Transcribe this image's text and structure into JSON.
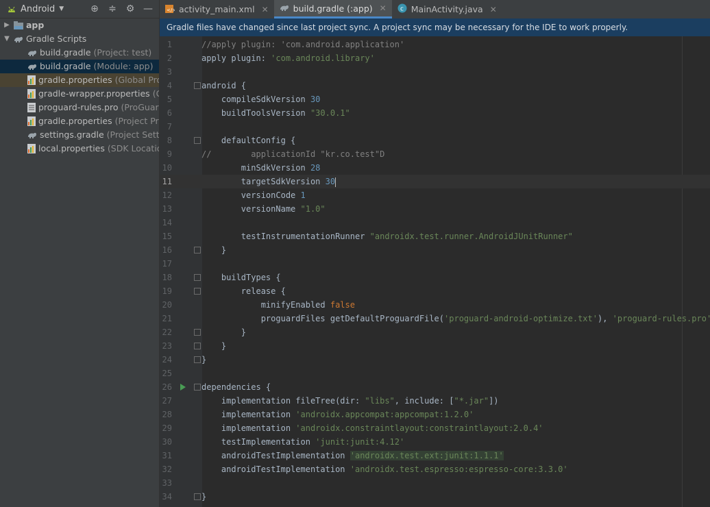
{
  "project_panel": {
    "view_label": "Android",
    "tree": [
      {
        "label": "app",
        "hint": "",
        "level": 0,
        "arrow": "▶",
        "icon": "folder-icon",
        "bold": true,
        "state": ""
      },
      {
        "label": "Gradle Scripts",
        "hint": "",
        "level": 0,
        "arrow": "▼",
        "icon": "gradle-icon",
        "bold": false,
        "state": ""
      },
      {
        "label": "build.gradle",
        "hint": "(Project: test)",
        "level": 1,
        "arrow": "",
        "icon": "gradle-icon",
        "bold": false,
        "state": ""
      },
      {
        "label": "build.gradle",
        "hint": "(Module: app)",
        "level": 1,
        "arrow": "",
        "icon": "gradle-icon",
        "bold": false,
        "state": "sel"
      },
      {
        "label": "gradle.properties",
        "hint": "(Global Properties)",
        "level": 1,
        "arrow": "",
        "icon": "properties-icon",
        "bold": false,
        "state": "hl"
      },
      {
        "label": "gradle-wrapper.properties",
        "hint": "(Gradle Version)",
        "level": 1,
        "arrow": "",
        "icon": "properties-icon",
        "bold": false,
        "state": ""
      },
      {
        "label": "proguard-rules.pro",
        "hint": "(ProGuard Rules for app)",
        "level": 1,
        "arrow": "",
        "icon": "file-icon",
        "bold": false,
        "state": ""
      },
      {
        "label": "gradle.properties",
        "hint": "(Project Properties)",
        "level": 1,
        "arrow": "",
        "icon": "properties-icon",
        "bold": false,
        "state": ""
      },
      {
        "label": "settings.gradle",
        "hint": "(Project Settings)",
        "level": 1,
        "arrow": "",
        "icon": "gradle-icon",
        "bold": false,
        "state": ""
      },
      {
        "label": "local.properties",
        "hint": "(SDK Location)",
        "level": 1,
        "arrow": "",
        "icon": "properties-icon",
        "bold": false,
        "state": ""
      }
    ]
  },
  "tabs": [
    {
      "label": "activity_main.xml",
      "icon": "xml-icon",
      "active": false
    },
    {
      "label": "build.gradle (:app)",
      "icon": "gradle-icon",
      "active": true
    },
    {
      "label": "MainActivity.java",
      "icon": "class-icon",
      "active": false
    }
  ],
  "banner": "Gradle files have changed since last project sync. A project sync may be necessary for the IDE to work properly.",
  "editor": {
    "current_line": 11,
    "lines": [
      {
        "n": "1",
        "html": "<span class='cmt'>//apply plugin: 'com.android.application'</span>"
      },
      {
        "n": "2",
        "html": "apply plugin: <span class='str'>'com.android.library'</span>"
      },
      {
        "n": "3",
        "html": ""
      },
      {
        "n": "4",
        "html": "android {",
        "fold": true
      },
      {
        "n": "5",
        "html": "    compileSdkVersion <span class='num'>30</span>"
      },
      {
        "n": "6",
        "html": "    buildToolsVersion <span class='str'>\"30.0.1\"</span>"
      },
      {
        "n": "7",
        "html": ""
      },
      {
        "n": "8",
        "html": "    defaultConfig {",
        "fold": true
      },
      {
        "n": "9",
        "html": "<span class='cmt'>//        applicationId \"kr.co.test\"D</span>"
      },
      {
        "n": "10",
        "html": "        minSdkVersion <span class='num'>28</span>"
      },
      {
        "n": "11",
        "html": "        targetSdkVersion <span class='num'>30</span><span class='caret'></span>"
      },
      {
        "n": "12",
        "html": "        versionCode <span class='num'>1</span>"
      },
      {
        "n": "13",
        "html": "        versionName <span class='str'>\"1.0\"</span>"
      },
      {
        "n": "14",
        "html": ""
      },
      {
        "n": "15",
        "html": "        testInstrumentationRunner <span class='str'>\"androidx.test.runner.AndroidJUnitRunner\"</span>"
      },
      {
        "n": "16",
        "html": "    }",
        "fold": true
      },
      {
        "n": "17",
        "html": ""
      },
      {
        "n": "18",
        "html": "    buildTypes {",
        "fold": true
      },
      {
        "n": "19",
        "html": "        release {",
        "fold": true
      },
      {
        "n": "20",
        "html": "            minifyEnabled <span class='kw'>false</span>"
      },
      {
        "n": "21",
        "html": "            proguardFiles getDefaultProguardFile(<span class='str'>'proguard-android-optimize.txt'</span>), <span class='str'>'proguard-rules.pro'</span>"
      },
      {
        "n": "22",
        "html": "        }",
        "fold": true
      },
      {
        "n": "23",
        "html": "    }",
        "fold": true
      },
      {
        "n": "24",
        "html": "}",
        "fold": true
      },
      {
        "n": "25",
        "html": ""
      },
      {
        "n": "26",
        "html": "dependencies {",
        "fold": true,
        "run": true
      },
      {
        "n": "27",
        "html": "    implementation fileTree(dir: <span class='str'>\"libs\"</span>, include: [<span class='str'>\"*.jar\"</span>])"
      },
      {
        "n": "28",
        "html": "    implementation <span class='str'>'androidx.appcompat:appcompat:1.2.0'</span>"
      },
      {
        "n": "29",
        "html": "    implementation <span class='str'>'androidx.constraintlayout:constraintlayout:2.0.4'</span>"
      },
      {
        "n": "30",
        "html": "    testImplementation <span class='str'>'junit:junit:4.12'</span>"
      },
      {
        "n": "31",
        "html": "    androidTestImplementation <span class='sel-str'>'androidx.test.ext:junit:1.1.1'</span>"
      },
      {
        "n": "32",
        "html": "    androidTestImplementation <span class='str'>'androidx.test.espresso:espresso-core:3.3.0'</span>"
      },
      {
        "n": "33",
        "html": ""
      },
      {
        "n": "34",
        "html": "}",
        "fold": true
      }
    ]
  },
  "colors": {
    "accent": "#4a88c7",
    "banner": "#1b3e60",
    "selection": "#0d293e"
  }
}
